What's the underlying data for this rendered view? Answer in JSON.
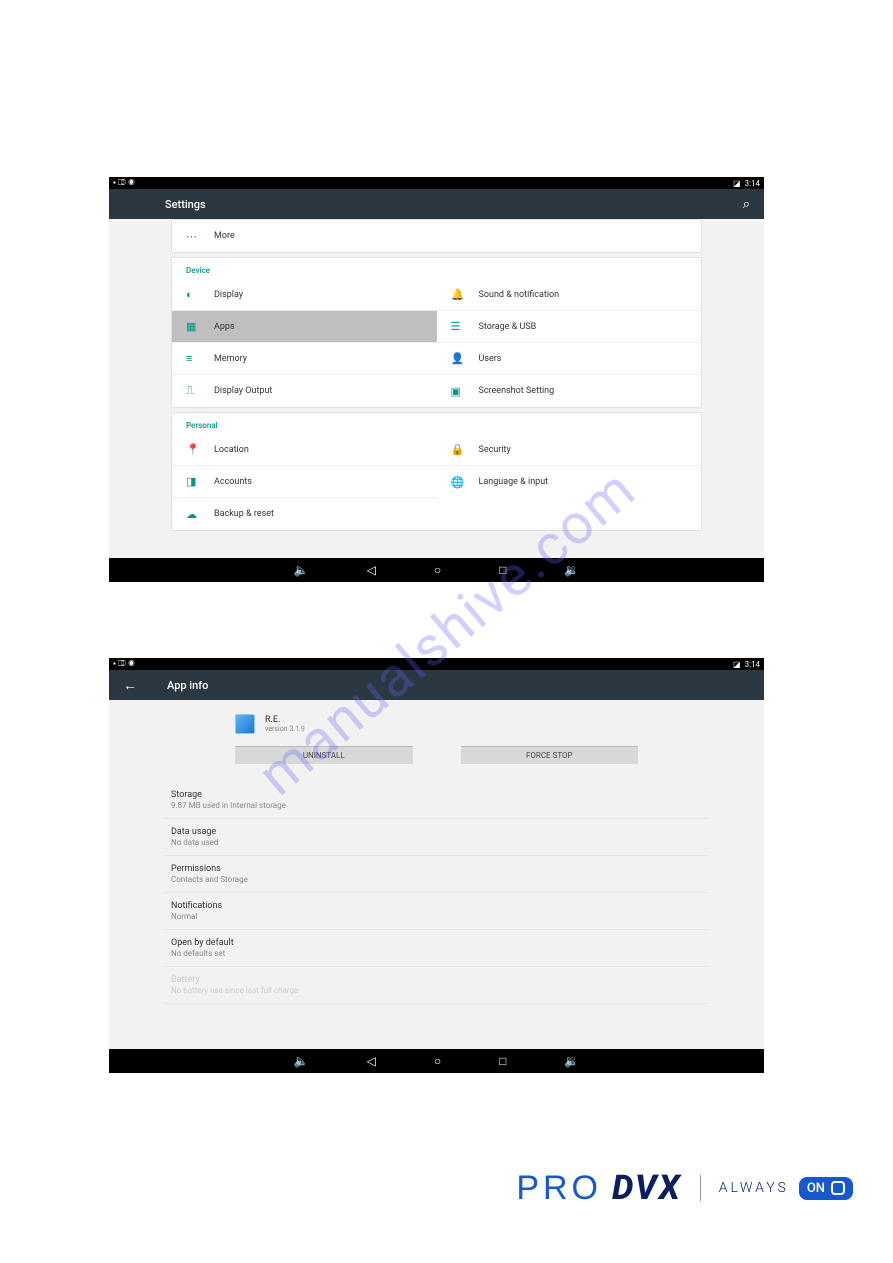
{
  "status": {
    "time": "3:14"
  },
  "screen1": {
    "title": "Settings",
    "more": "More",
    "categories": {
      "device": {
        "header": "Device",
        "left": [
          {
            "icon": "◐",
            "label": "Display",
            "name": "display"
          },
          {
            "icon": "▦",
            "label": "Apps",
            "name": "apps",
            "selected": true
          },
          {
            "icon": "≡",
            "label": "Memory",
            "name": "memory"
          },
          {
            "icon": "⎍",
            "label": "Display Output",
            "name": "display-output"
          }
        ],
        "right": [
          {
            "icon": "🔔",
            "label": "Sound & notification",
            "name": "sound"
          },
          {
            "icon": "☰",
            "label": "Storage & USB",
            "name": "storage"
          },
          {
            "icon": "👤",
            "label": "Users",
            "name": "users"
          },
          {
            "icon": "▣",
            "label": "Screenshot Setting",
            "name": "screenshot"
          }
        ]
      },
      "personal": {
        "header": "Personal",
        "left": [
          {
            "icon": "📍",
            "label": "Location",
            "name": "location"
          },
          {
            "icon": "◨",
            "label": "Accounts",
            "name": "accounts"
          },
          {
            "icon": "☁",
            "label": "Backup & reset",
            "name": "backup"
          }
        ],
        "right": [
          {
            "icon": "🔒",
            "label": "Security",
            "name": "security"
          },
          {
            "icon": "🌐",
            "label": "Language & input",
            "name": "language"
          }
        ]
      }
    }
  },
  "screen2": {
    "title": "App info",
    "app": {
      "name": "R.E.",
      "version": "version 3.1.9"
    },
    "buttons": {
      "uninstall": "UNINSTALL",
      "force_stop": "FORCE STOP"
    },
    "items": [
      {
        "title": "Storage",
        "sub": "9.87 MB used in Internal storage"
      },
      {
        "title": "Data usage",
        "sub": "No data used"
      },
      {
        "title": "Permissions",
        "sub": "Contacts and Storage"
      },
      {
        "title": "Notifications",
        "sub": "Normal"
      },
      {
        "title": "Open by default",
        "sub": "No defaults set"
      },
      {
        "title": "Battery",
        "sub": "No battery use since last full charge",
        "disabled": true
      }
    ]
  },
  "watermark": "manualshive.com",
  "footer": {
    "pro": "PRO",
    "dvx": "DVX",
    "always": "ALWAYS",
    "on": "ON"
  }
}
